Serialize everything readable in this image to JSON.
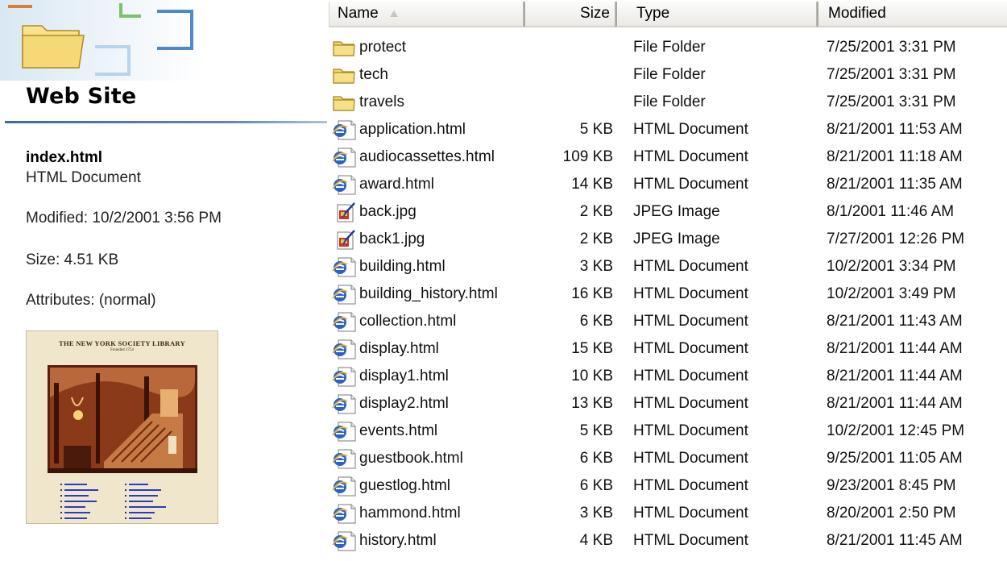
{
  "details": {
    "title": "Web Site",
    "name": "index.html",
    "type": "HTML Document",
    "modified": "Modified: 10/2/2001 3:56 PM",
    "size": "Size: 4.51 KB",
    "attributes": "Attributes: (normal)",
    "thumbnail": {
      "title": "THE NEW YORK SOCIETY LIBRARY",
      "subtitle": "Founded 1754"
    }
  },
  "columns": {
    "name": "Name",
    "size": "Size",
    "type": "Type",
    "modified": "Modified"
  },
  "icons": {
    "folder": "folder-icon",
    "html": "html-document-icon",
    "jpeg": "jpeg-image-icon"
  },
  "colors": {
    "rule": "#3b6aa8",
    "folder": "#f3d56a",
    "html": "#2a62c6"
  },
  "files": [
    {
      "name": "protect",
      "size": "",
      "type": "File Folder",
      "modified": "7/25/2001 3:31 PM",
      "kind": "folder"
    },
    {
      "name": "tech",
      "size": "",
      "type": "File Folder",
      "modified": "7/25/2001 3:31 PM",
      "kind": "folder"
    },
    {
      "name": "travels",
      "size": "",
      "type": "File Folder",
      "modified": "7/25/2001 3:31 PM",
      "kind": "folder"
    },
    {
      "name": "application.html",
      "size": "5 KB",
      "type": "HTML Document",
      "modified": "8/21/2001 11:53 AM",
      "kind": "html"
    },
    {
      "name": "audiocassettes.html",
      "size": "109 KB",
      "type": "HTML Document",
      "modified": "8/21/2001 11:18 AM",
      "kind": "html"
    },
    {
      "name": "award.html",
      "size": "14 KB",
      "type": "HTML Document",
      "modified": "8/21/2001 11:35 AM",
      "kind": "html"
    },
    {
      "name": "back.jpg",
      "size": "2 KB",
      "type": "JPEG Image",
      "modified": "8/1/2001 11:46 AM",
      "kind": "jpeg"
    },
    {
      "name": "back1.jpg",
      "size": "2 KB",
      "type": "JPEG Image",
      "modified": "7/27/2001 12:26 PM",
      "kind": "jpeg"
    },
    {
      "name": "building.html",
      "size": "3 KB",
      "type": "HTML Document",
      "modified": "10/2/2001 3:34 PM",
      "kind": "html"
    },
    {
      "name": "building_history.html",
      "size": "16 KB",
      "type": "HTML Document",
      "modified": "10/2/2001 3:49 PM",
      "kind": "html"
    },
    {
      "name": "collection.html",
      "size": "6 KB",
      "type": "HTML Document",
      "modified": "8/21/2001 11:43 AM",
      "kind": "html"
    },
    {
      "name": "display.html",
      "size": "15 KB",
      "type": "HTML Document",
      "modified": "8/21/2001 11:44 AM",
      "kind": "html"
    },
    {
      "name": "display1.html",
      "size": "10 KB",
      "type": "HTML Document",
      "modified": "8/21/2001 11:44 AM",
      "kind": "html"
    },
    {
      "name": "display2.html",
      "size": "13 KB",
      "type": "HTML Document",
      "modified": "8/21/2001 11:44 AM",
      "kind": "html"
    },
    {
      "name": "events.html",
      "size": "5 KB",
      "type": "HTML Document",
      "modified": "10/2/2001 12:45 PM",
      "kind": "html"
    },
    {
      "name": "guestbook.html",
      "size": "6 KB",
      "type": "HTML Document",
      "modified": "9/25/2001 11:05 AM",
      "kind": "html"
    },
    {
      "name": "guestlog.html",
      "size": "6 KB",
      "type": "HTML Document",
      "modified": "9/23/2001 8:45 PM",
      "kind": "html"
    },
    {
      "name": "hammond.html",
      "size": "3 KB",
      "type": "HTML Document",
      "modified": "8/20/2001 2:50 PM",
      "kind": "html"
    },
    {
      "name": "history.html",
      "size": "4 KB",
      "type": "HTML Document",
      "modified": "8/21/2001 11:45 AM",
      "kind": "html"
    }
  ]
}
